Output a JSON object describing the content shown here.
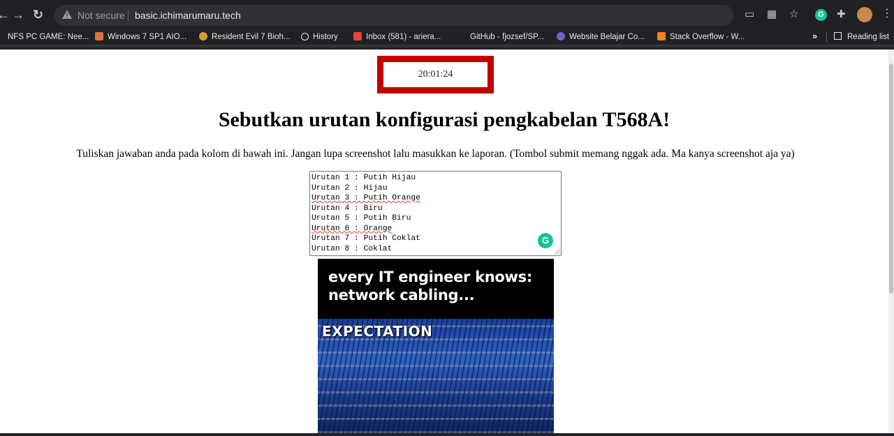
{
  "browser": {
    "security_label": "Not secure",
    "url": "basic.ichimarumaru.tech",
    "bookmarks": [
      "NFS PC GAME: Nee...",
      "Windows 7 SP1 AIO...",
      "Resident Evil 7 Bioh...",
      "History",
      "Inbox (581) - ariera...",
      "GitHub - fjozsef/SP...",
      "Website Belajar Co...",
      "Stack Overflow - W..."
    ],
    "more_bookmarks": "»",
    "reading_list": "Reading list"
  },
  "page": {
    "clock": "20:01:24",
    "question": "Sebutkan urutan konfigurasi pengkabelan T568A!",
    "instruction": "Tuliskan jawaban anda pada kolom di bawah ini. Jangan lupa screenshot lalu masukkan ke laporan. (Tombol submit memang nggak ada. Ma kanya screenshot aja ya)",
    "answer_lines": [
      "Urutan 1 : Putih Hijau",
      "Urutan 2 : Hijau",
      "Urutan 3 : Putih Orange",
      "Urutan 4 : Biru",
      "Urutan 5 : Putih Biru",
      "Urutan 6 : Orange",
      "Urutan 7 : Putih Coklat",
      "Urutan 8 : Coklat"
    ],
    "meme": {
      "caption": "every IT engineer knows: network cabling...",
      "label": "EXPECTATION"
    }
  },
  "colors": {
    "clock_border": "#c00000",
    "grammarly": "#15c39a",
    "browser_bg": "#202124"
  }
}
